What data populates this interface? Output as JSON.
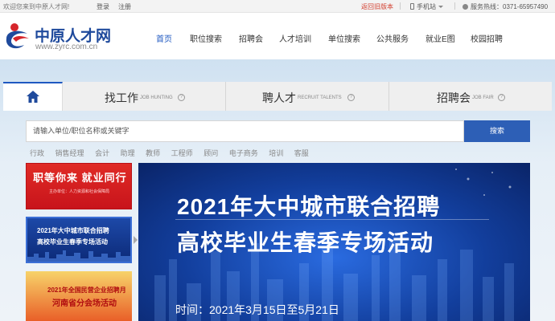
{
  "topbar": {
    "welcome": "欢迎您来到中原人才网!",
    "login": "登录",
    "register": "注册",
    "old_version": "返回旧版本",
    "mobile": "手机站",
    "hotline": "服务热线：0371-65957490"
  },
  "logo": {
    "cn": "中原人才网",
    "en": "www.zyrc.com.cn"
  },
  "nav": [
    "首页",
    "职位搜索",
    "招聘会",
    "人才培训",
    "单位搜索",
    "公共服务",
    "就业E图",
    "校园招聘"
  ],
  "tabs": [
    {
      "name": "找工作",
      "sub": "JOB HUNTING"
    },
    {
      "name": "聘人才",
      "sub": "RECRUIT TALENTS"
    },
    {
      "name": "招聘会",
      "sub": "JOB FAIR"
    }
  ],
  "search": {
    "placeholder": "请输入单位/职位名称或关键字",
    "button": "搜索"
  },
  "hotwords": [
    "行政",
    "销售经理",
    "会计",
    "助理",
    "教师",
    "工程师",
    "顾问",
    "电子商务",
    "培训",
    "客服"
  ],
  "ads": {
    "ad1": {
      "title": "职等你来  就业同行",
      "sub": "主办单位：人力资源和社会保障局"
    },
    "ad2": {
      "line1": "2021年大中城市联合招聘",
      "line2": "高校毕业生春季专场活动"
    },
    "ad3": {
      "line1": "2021年全国民营企业招聘月",
      "line2": "河南省分会场活动"
    }
  },
  "banner": {
    "line1": "2021年大中城市联合招聘",
    "line2": "高校毕业生春季专场活动",
    "date": "时间：2021年3月15日至5月21日"
  },
  "colors": {
    "brand": "#1f4a9c",
    "accent": "#2d5fb6",
    "alert": "#d23c2c"
  }
}
